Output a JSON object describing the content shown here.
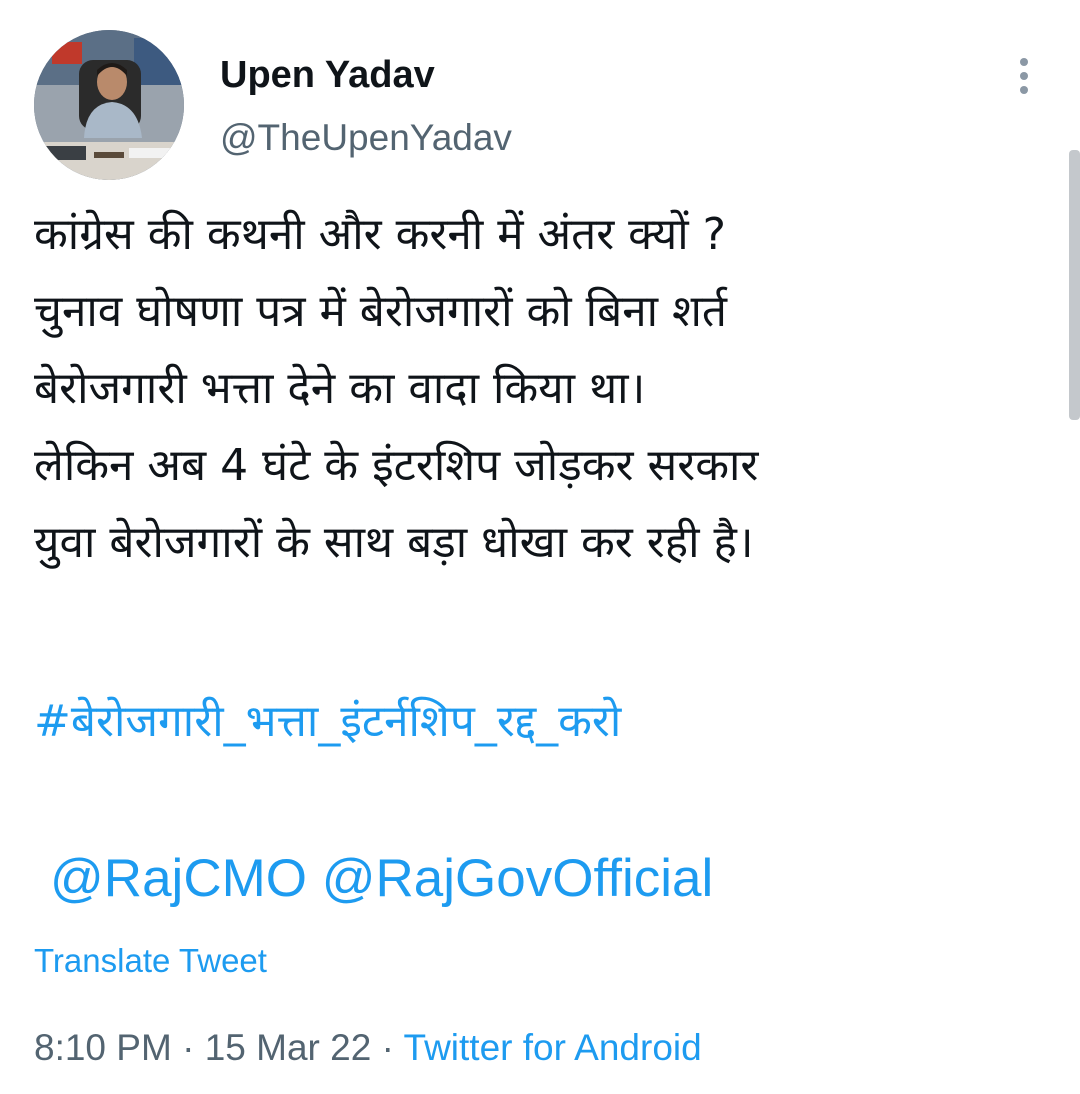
{
  "author": {
    "display_name": "Upen Yadav",
    "handle": "@TheUpenYadav"
  },
  "tweet": {
    "lines": [
      "कांग्रेस की कथनी और करनी में अंतर क्यों ?",
      "चुनाव घोषणा पत्र में बेरोजगारों को बिना शर्त",
      "बेरोजगारी भत्ता देने का वादा किया था।",
      "लेकिन अब 4 घंटे के इंटरशिप जोड़कर सरकार",
      "युवा बेरोजगारों के साथ बड़ा धोखा कर रही है।"
    ],
    "hashtag": "#बेरोजगारी_भत्ता_इंटर्नशिप_रद्द_करो",
    "mentions": [
      "@RajCMO",
      "@RajGovOfficial"
    ],
    "translate_label": "Translate Tweet"
  },
  "meta": {
    "time": "8:10 PM",
    "separator": "·",
    "date": "15 Mar 22",
    "source": "Twitter for Android"
  },
  "icons": {
    "more": "more-vertical-icon"
  },
  "colors": {
    "link": "#1d9bf0",
    "text": "#0f1419",
    "secondary": "#536471"
  }
}
